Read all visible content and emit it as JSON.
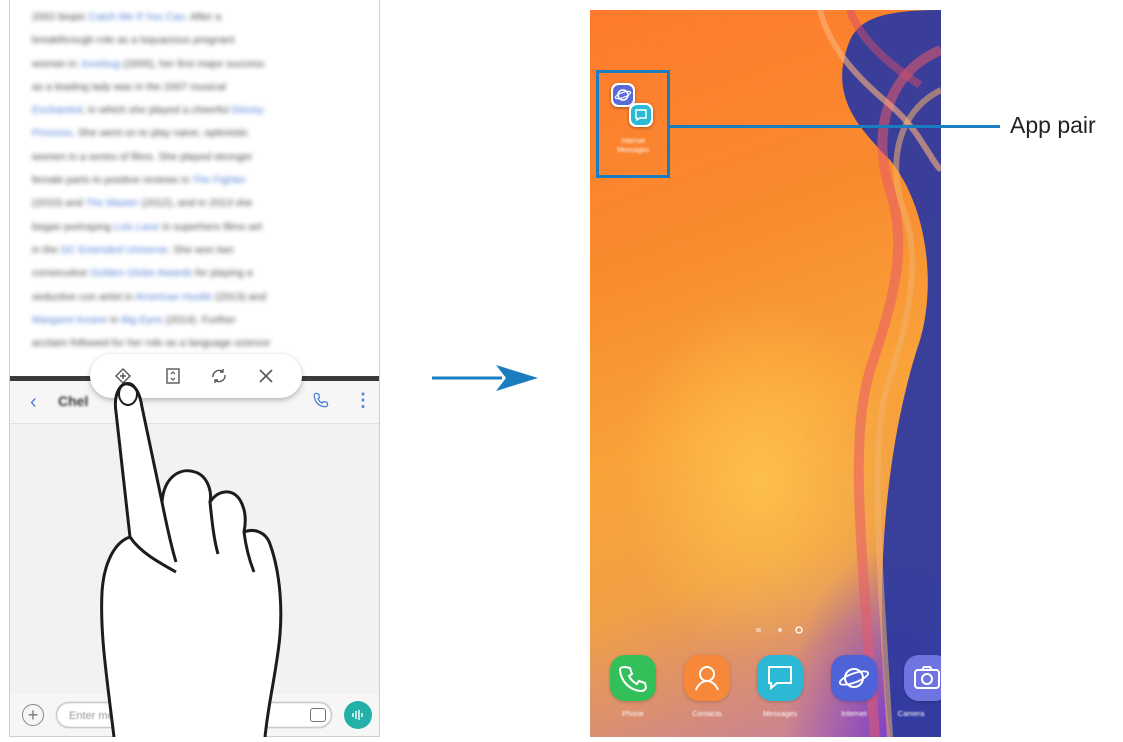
{
  "left_phone": {
    "article": {
      "lines": [
        [
          {
            "t": "2002 biopic "
          },
          {
            "t": "Catch Me If You Can",
            "link": true
          },
          {
            "t": ". After a"
          }
        ],
        [
          {
            "t": "breakthrough role as a loquacious pregnant"
          }
        ],
        [
          {
            "t": "woman in "
          },
          {
            "t": "Junebug",
            "link": true
          },
          {
            "t": " (2005), her first major success"
          }
        ],
        [
          {
            "t": "as a leading lady was in the 2007 musical"
          }
        ],
        [
          {
            "t": "Enchanted",
            "link": true
          },
          {
            "t": ", in which she played a cheerful "
          },
          {
            "t": "Disney",
            "link": true
          }
        ],
        [
          {
            "t": "Princess",
            "link": true
          },
          {
            "t": ". She went on to play naive, optimistic"
          }
        ],
        [
          {
            "t": "women in a series of films. She played stronger"
          }
        ],
        [
          {
            "t": "female parts to positive reviews in "
          },
          {
            "t": "The Fighter",
            "link": true
          }
        ],
        [
          {
            "t": "(2010) and "
          },
          {
            "t": "The Master",
            "link": true
          },
          {
            "t": " (2012), and in 2013 she"
          }
        ],
        [
          {
            "t": "began portraying "
          },
          {
            "t": "Lois Lane",
            "link": true
          },
          {
            "t": " in superhero films set"
          }
        ],
        [
          {
            "t": "in the "
          },
          {
            "t": "DC Extended Universe",
            "link": true
          },
          {
            "t": ". She won two"
          }
        ],
        [
          {
            "t": "consecutive "
          },
          {
            "t": "Golden Globe Awards",
            "link": true
          },
          {
            "t": " for playing a"
          }
        ],
        [
          {
            "t": "seductive con artist in "
          },
          {
            "t": "American Hustle",
            "link": true
          },
          {
            "t": " (2013) and"
          }
        ],
        [
          {
            "t": "Margaret Keane",
            "link": true
          },
          {
            "t": " in "
          },
          {
            "t": "Big Eyes",
            "link": true
          },
          {
            "t": " (2014). Further"
          }
        ],
        [
          {
            "t": "acclaim followed for her role as a language science"
          }
        ]
      ]
    },
    "chat": {
      "back_icon": "chevron-left-icon",
      "contact_name": "Chel",
      "call_icon": "phone-icon",
      "more_icon": "more-vertical-icon"
    },
    "composer": {
      "plus": "+",
      "placeholder": "Enter message",
      "sticker_icon": "sticker-icon",
      "voice_icon": "voice-record-icon"
    },
    "popup_icons": [
      "add-app-pair-icon",
      "swap-windows-icon",
      "rotate-icon",
      "close-icon"
    ]
  },
  "home_screen": {
    "folder": {
      "apps": [
        "internet-app-icon",
        "messages-app-icon"
      ],
      "label_lines": [
        "Internet",
        "Messages"
      ]
    },
    "dock": [
      {
        "name": "Phone",
        "icon": "phone-icon",
        "color": "#33c05a"
      },
      {
        "name": "Contacts",
        "icon": "contacts-icon",
        "color": "#f7883a"
      },
      {
        "name": "Messages",
        "icon": "messages-icon",
        "color": "#2bb9d6"
      },
      {
        "name": "Internet",
        "icon": "internet-icon",
        "color": "#4e63d8"
      },
      {
        "name": "Camera",
        "icon": "camera-icon",
        "color": "#6f74e0"
      }
    ]
  },
  "callout": {
    "label": "App pair"
  },
  "colors": {
    "callout": "#1a7dbf",
    "arrow": "#1a7dbf"
  }
}
